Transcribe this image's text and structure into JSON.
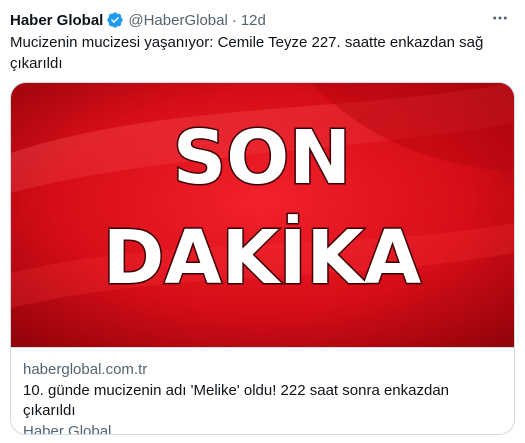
{
  "tweet": {
    "author_name": "Haber Global",
    "handle": "@HaberGlobal",
    "separator": "·",
    "time": "12d",
    "text": "Mucizenin mucizesi yaşanıyor:  Cemile Teyze 227. saatte enkazdan sağ çıkarıldı"
  },
  "card": {
    "image_text_line1": "SON",
    "image_text_line2": "DAKİKA",
    "domain": "haberglobal.com.tr",
    "title": "10. günde mucizenin adı 'Melike' oldu! 222 saat sonra enkazdan çıkarıldı",
    "source": "Haber Global"
  },
  "icons": {
    "verified": "verified-badge-icon",
    "more": "more-options-icon"
  },
  "colors": {
    "verified_blue": "#1d9bf0",
    "banner_red": "#e0101c",
    "text_primary": "#0f1419",
    "text_secondary": "#536471",
    "border": "#cfd9de"
  }
}
